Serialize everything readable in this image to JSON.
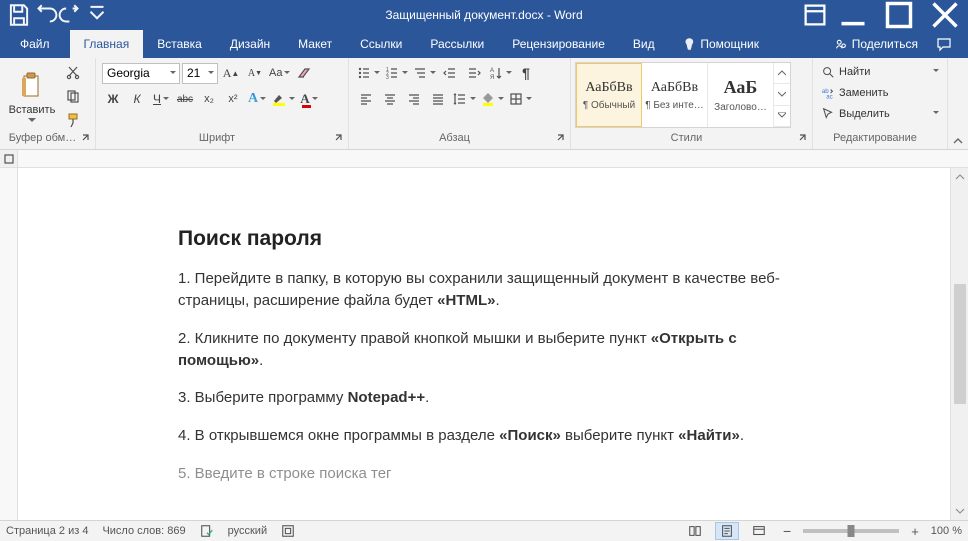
{
  "titlebar": {
    "doc_title": "Защищенный документ.docx  -  Word"
  },
  "tabs": {
    "file": "Файл",
    "home": "Главная",
    "insert": "Вставка",
    "design": "Дизайн",
    "layout": "Макет",
    "references": "Ссылки",
    "mailings": "Рассылки",
    "review": "Рецензирование",
    "view": "Вид",
    "assistant": "Помощник",
    "share": "Поделиться"
  },
  "ribbon": {
    "clipboard": {
      "label": "Буфер обм…",
      "paste": "Вставить"
    },
    "font": {
      "label": "Шрифт",
      "name": "Georgia",
      "size": "21",
      "bold": "Ж",
      "italic": "К",
      "underline": "Ч",
      "strike": "abc",
      "sub": "x₂",
      "sup": "x²",
      "aa_case": "Aa"
    },
    "paragraph": {
      "label": "Абзац"
    },
    "styles": {
      "label": "Стили",
      "sample": "АаБбВв",
      "sample_title": "АаБ",
      "s1": "¶ Обычный",
      "s2": "¶ Без инте…",
      "s3": "Заголово…"
    },
    "editing": {
      "label": "Редактирование",
      "find": "Найти",
      "replace": "Заменить",
      "select": "Выделить"
    }
  },
  "document": {
    "heading": "Поиск пароля",
    "p1a": "1. Перейдите в папку, в которую вы сохранили защищенный документ в качестве веб-страницы, расширение файла будет ",
    "p1b": "«HTML»",
    "p1c": ".",
    "p2a": "2. Кликните по документу правой кнопкой мышки и выберите пункт ",
    "p2b": "«Открыть с помощью»",
    "p2c": ".",
    "p3a": "3. Выберите программу ",
    "p3b": "Notepad++",
    "p3c": ".",
    "p4a": "4. В открывшемся окне программы в разделе ",
    "p4b": "«Поиск»",
    "p4c": " выберите пункт ",
    "p4d": "«Найти»",
    "p4e": ".",
    "p5a": "5. Введите в строке поиска тег"
  },
  "status": {
    "page": "Страница 2 из 4",
    "words": "Число слов: 869",
    "lang": "русский",
    "zoom": "100 %"
  }
}
